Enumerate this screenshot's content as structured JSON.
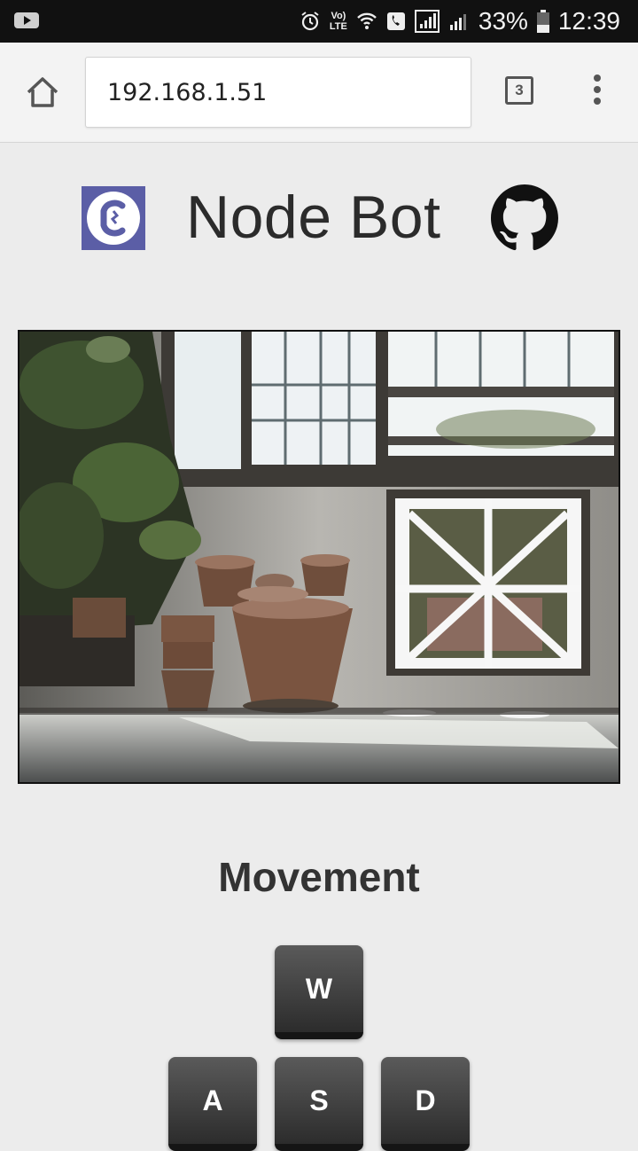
{
  "status_bar": {
    "left_icon": "youtube-notification-icon",
    "volte_line1": "Vo)",
    "volte_line2": "LTE",
    "icons": [
      "alarm-icon",
      "volte-icon",
      "wifi-calling-icon",
      "call-icon",
      "signal-icon",
      "signal-icon"
    ],
    "battery": "33%",
    "time": "12:39"
  },
  "browser": {
    "url": "192.168.1.51",
    "tab_count": "3",
    "home_icon": "home-icon",
    "menu_icon": "more-vert-icon"
  },
  "header": {
    "logo_icon": "app-logo-icon",
    "title": "Node Bot",
    "github_icon": "github-icon"
  },
  "camera": {
    "feed_icon": "camera-feed-image"
  },
  "movement": {
    "title": "Movement",
    "keys": {
      "w": "W",
      "a": "A",
      "s": "S",
      "d": "D"
    }
  },
  "colors": {
    "page_background": "#ececec",
    "status_bar": "#111111",
    "logo_accent": "#5b5ea6",
    "key_background": "#3a3a3a"
  }
}
